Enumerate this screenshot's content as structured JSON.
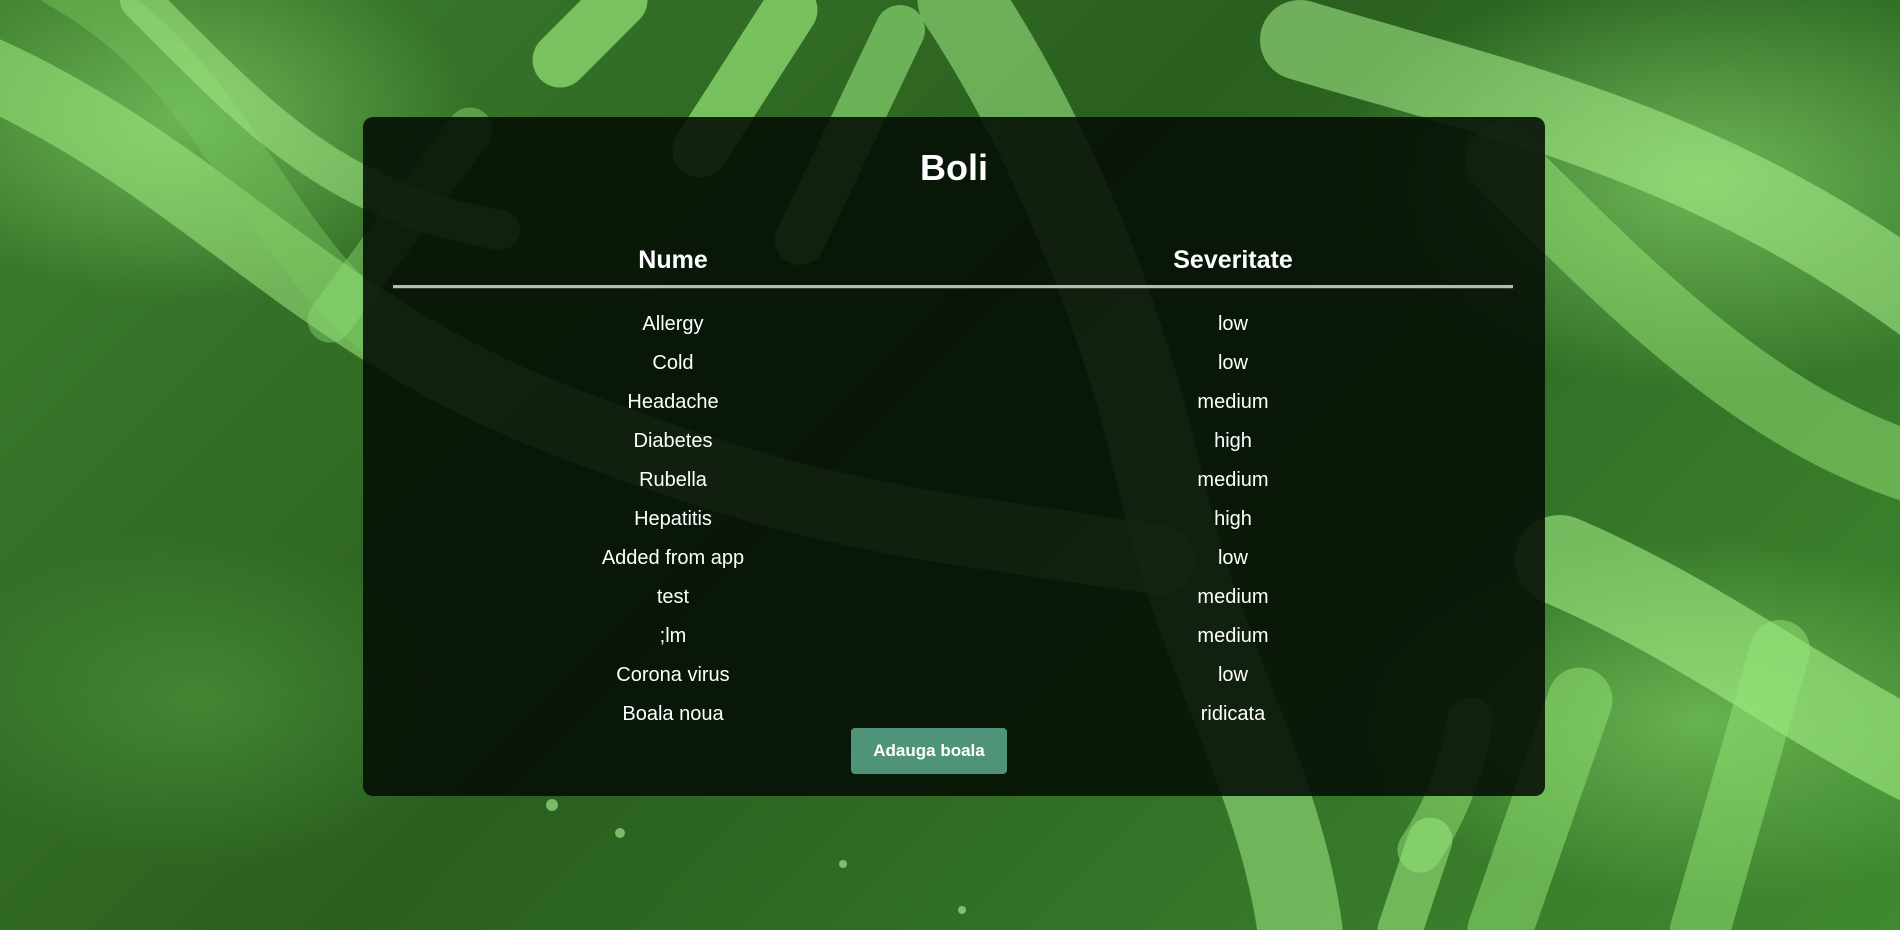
{
  "page": {
    "title": "Boli",
    "accent_color": "#4f9478",
    "background_theme": "green-dna"
  },
  "table": {
    "headers": [
      "Nume",
      "Severitate"
    ],
    "rows": [
      [
        "Allergy",
        "low"
      ],
      [
        "Cold",
        "low"
      ],
      [
        "Headache",
        "medium"
      ],
      [
        "Diabetes",
        "high"
      ],
      [
        "Rubella",
        "medium"
      ],
      [
        "Hepatitis",
        "high"
      ],
      [
        "Added from app",
        "low"
      ],
      [
        "test",
        "medium"
      ],
      [
        ";lm",
        "medium"
      ],
      [
        "Corona virus",
        "low"
      ],
      [
        "Boala noua",
        "ridicata"
      ]
    ]
  },
  "actions": {
    "add_label": "Adauga boala"
  }
}
